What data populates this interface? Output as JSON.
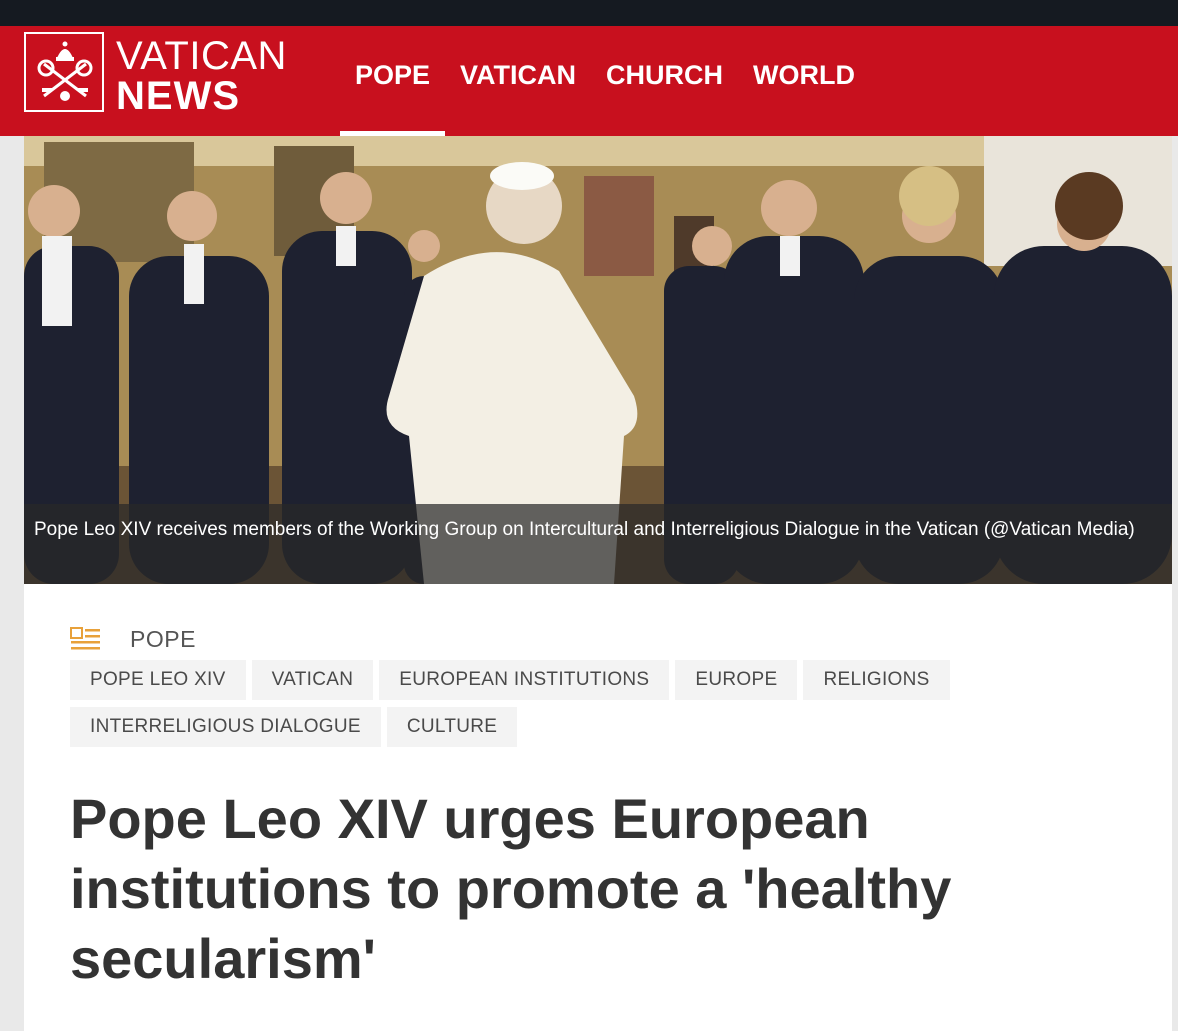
{
  "header": {
    "logo_line1": "VATICAN",
    "logo_line2": "NEWS",
    "nav": [
      "POPE",
      "VATICAN",
      "CHURCH",
      "WORLD"
    ],
    "active_nav": "POPE",
    "brand_color": "#c8101e"
  },
  "photo": {
    "caption": "Pope Leo XIV receives members of the Working Group on Intercultural and Interreligious Dialogue in the Vatican (@Vatican Media)"
  },
  "article": {
    "section_icon": "news-section-icon",
    "section": "POPE",
    "tags_row1": [
      "POPE LEO XIV",
      "VATICAN",
      "EUROPEAN INSTITUTIONS",
      "EUROPE",
      "RELIGIONS"
    ],
    "tags_row2": [
      "INTERRELIGIOUS DIALOGUE",
      "CULTURE"
    ],
    "headline": "Pope Leo XIV urges European institutions to promote a 'healthy secularism'"
  },
  "overlay": {
    "like_icon": "heart-icon"
  }
}
